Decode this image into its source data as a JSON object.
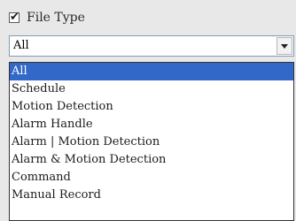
{
  "filter": {
    "checkbox": {
      "label": "File Type",
      "checked": true,
      "check_glyph": "✔",
      "icon": "checkmark-icon"
    },
    "select": {
      "value": "All",
      "arrow_icon": "chevron-down-icon",
      "options": [
        {
          "label": "All",
          "selected": true
        },
        {
          "label": "Schedule",
          "selected": false
        },
        {
          "label": "Motion Detection",
          "selected": false
        },
        {
          "label": "Alarm Handle",
          "selected": false
        },
        {
          "label": "Alarm | Motion Detection",
          "selected": false
        },
        {
          "label": "Alarm & Motion Detection",
          "selected": false
        },
        {
          "label": "Command",
          "selected": false
        },
        {
          "label": "Manual Record",
          "selected": false
        }
      ]
    }
  },
  "colors": {
    "selection_bg": "#3268c8",
    "selection_text": "#ffffff",
    "panel_bg": "#e8e8e8"
  }
}
